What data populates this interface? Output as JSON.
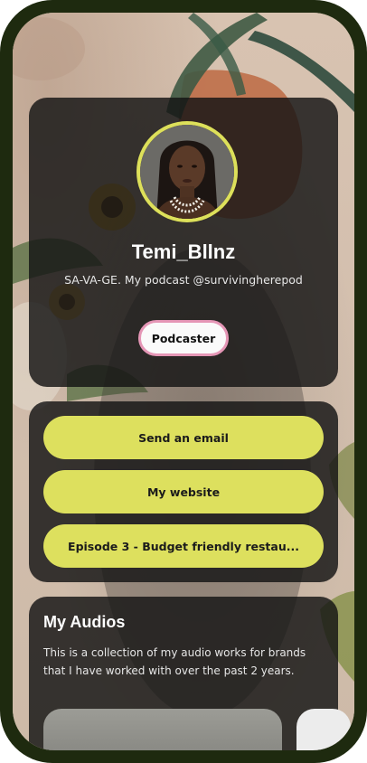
{
  "profile": {
    "username": "Temi_Bllnz",
    "bio": "SA-VA-GE. My podcast @survivingherepod",
    "tag": "Podcaster"
  },
  "links": [
    {
      "label": "Send an email"
    },
    {
      "label": "My website"
    },
    {
      "label": "Episode 3 - Budget friendly restau..."
    }
  ],
  "audios": {
    "title": "My Audios",
    "description": "This is a collection of my audio works for brands that I have worked with over the past 2 years."
  },
  "colors": {
    "frame": "#1e2a0f",
    "accent": "#dde05e",
    "tag_border": "#e596b6",
    "card_bg": "#141414"
  }
}
